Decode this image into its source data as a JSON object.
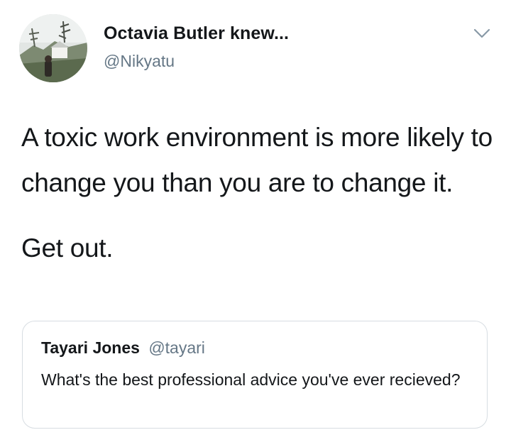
{
  "tweet": {
    "author": {
      "display_name": "Octavia Butler knew...",
      "handle": "@Nikyatu",
      "avatar_icon": "profile-photo"
    },
    "menu_icon": "chevron-down-icon",
    "text_paragraphs": [
      "A toxic work environment is more likely to change you than you are to change it.",
      "Get out."
    ],
    "quoted_tweet": {
      "display_name": "Tayari Jones",
      "handle": "@tayari",
      "text": "What's the best professional advice you've ever recieved?"
    }
  },
  "colors": {
    "text_primary": "#14171a",
    "text_secondary": "#657786",
    "border": "#d7dde2"
  }
}
